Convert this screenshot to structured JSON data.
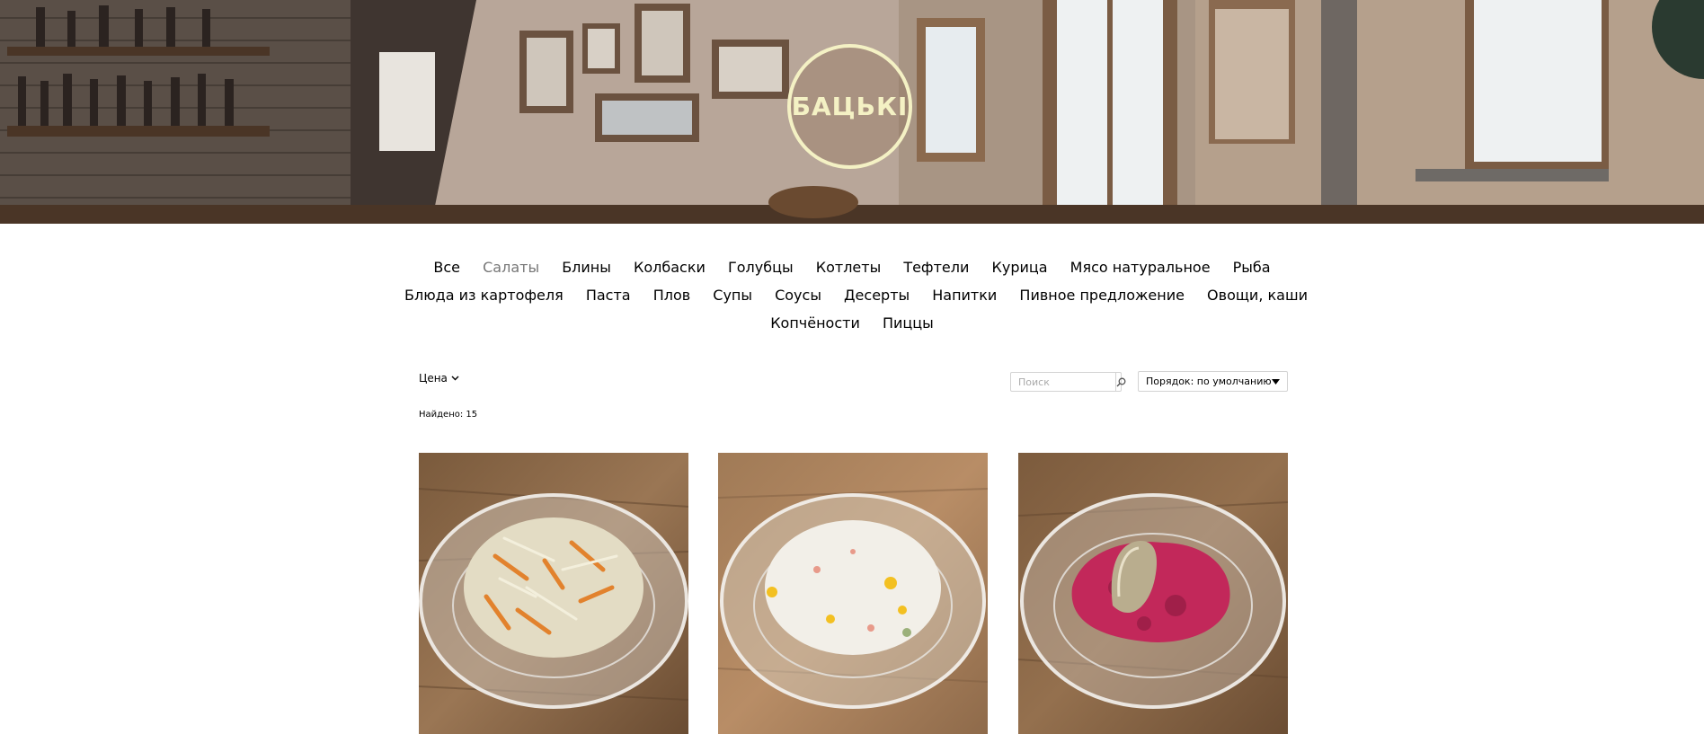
{
  "brand": {
    "logo_text": "БАЦЬКI",
    "logo_color": "#f4f1c4"
  },
  "categories": {
    "row1": [
      "Все",
      "Салаты",
      "Блины",
      "Колбаски",
      "Голубцы",
      "Котлеты",
      "Тефтели",
      "Курица",
      "Мясо натуральное",
      "Рыба"
    ],
    "row2": [
      "Блюда из картофеля",
      "Паста",
      "Плов",
      "Супы",
      "Соусы",
      "Десерты",
      "Напитки",
      "Пивное предложение",
      "Овощи, каши"
    ],
    "row3": [
      "Копчёности",
      "Пиццы"
    ],
    "active": "Салаты",
    "active_color": "#777777"
  },
  "filter": {
    "price_label": "Цена",
    "icon": "chevron-down-icon"
  },
  "search": {
    "placeholder": "Поиск",
    "value": "",
    "icon": "search-icon"
  },
  "sort": {
    "label": "Порядок: по умолчанию",
    "icon": "caret-down-icon"
  },
  "results": {
    "found_text": "Найдено: 15",
    "count": 15
  },
  "products": [
    {
      "image": "cabbage-carrot-salad-photo"
    },
    {
      "image": "crab-stick-corn-salad-photo"
    },
    {
      "image": "herring-under-beet-coat-salad-photo"
    }
  ]
}
